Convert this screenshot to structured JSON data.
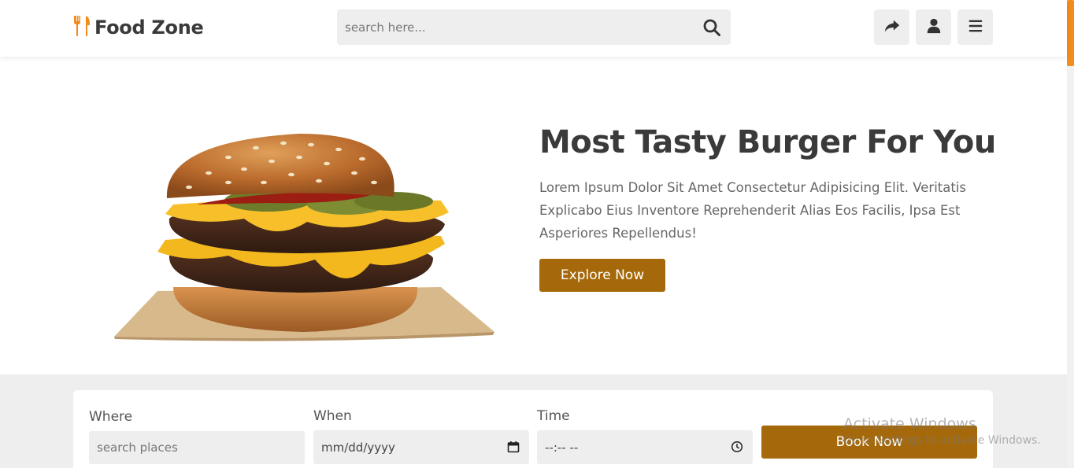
{
  "header": {
    "brand": "Food Zone",
    "search_placeholder": "search here...",
    "icons": [
      "utensils-icon",
      "search-icon",
      "share-icon",
      "user-icon",
      "menu-icon"
    ]
  },
  "hero": {
    "title": "Most Tasty Burger For You",
    "text": "Lorem Ipsum Dolor Sit Amet Consectetur Adipisicing Elit. Veritatis Explicabo Eius Inventore Reprehenderit Alias Eos Facilis, Ipsa Est Asperiores Repellendus!",
    "button_label": "Explore Now",
    "image": "burger"
  },
  "booking": {
    "where_label": "Where",
    "where_placeholder": "search places",
    "when_label": "When",
    "when_value": "mm/dd/yyyy",
    "time_label": "Time",
    "time_value": "--:-- --",
    "button_label": "Book Now"
  },
  "watermark": {
    "line1": "Activate Windows",
    "line2": "Go to Settings to activate Windows."
  },
  "colors": {
    "accent": "#a5690b",
    "logo_accent": "#f28c1c",
    "heading": "#3a3a3a",
    "field_bg": "#eeeeee"
  }
}
